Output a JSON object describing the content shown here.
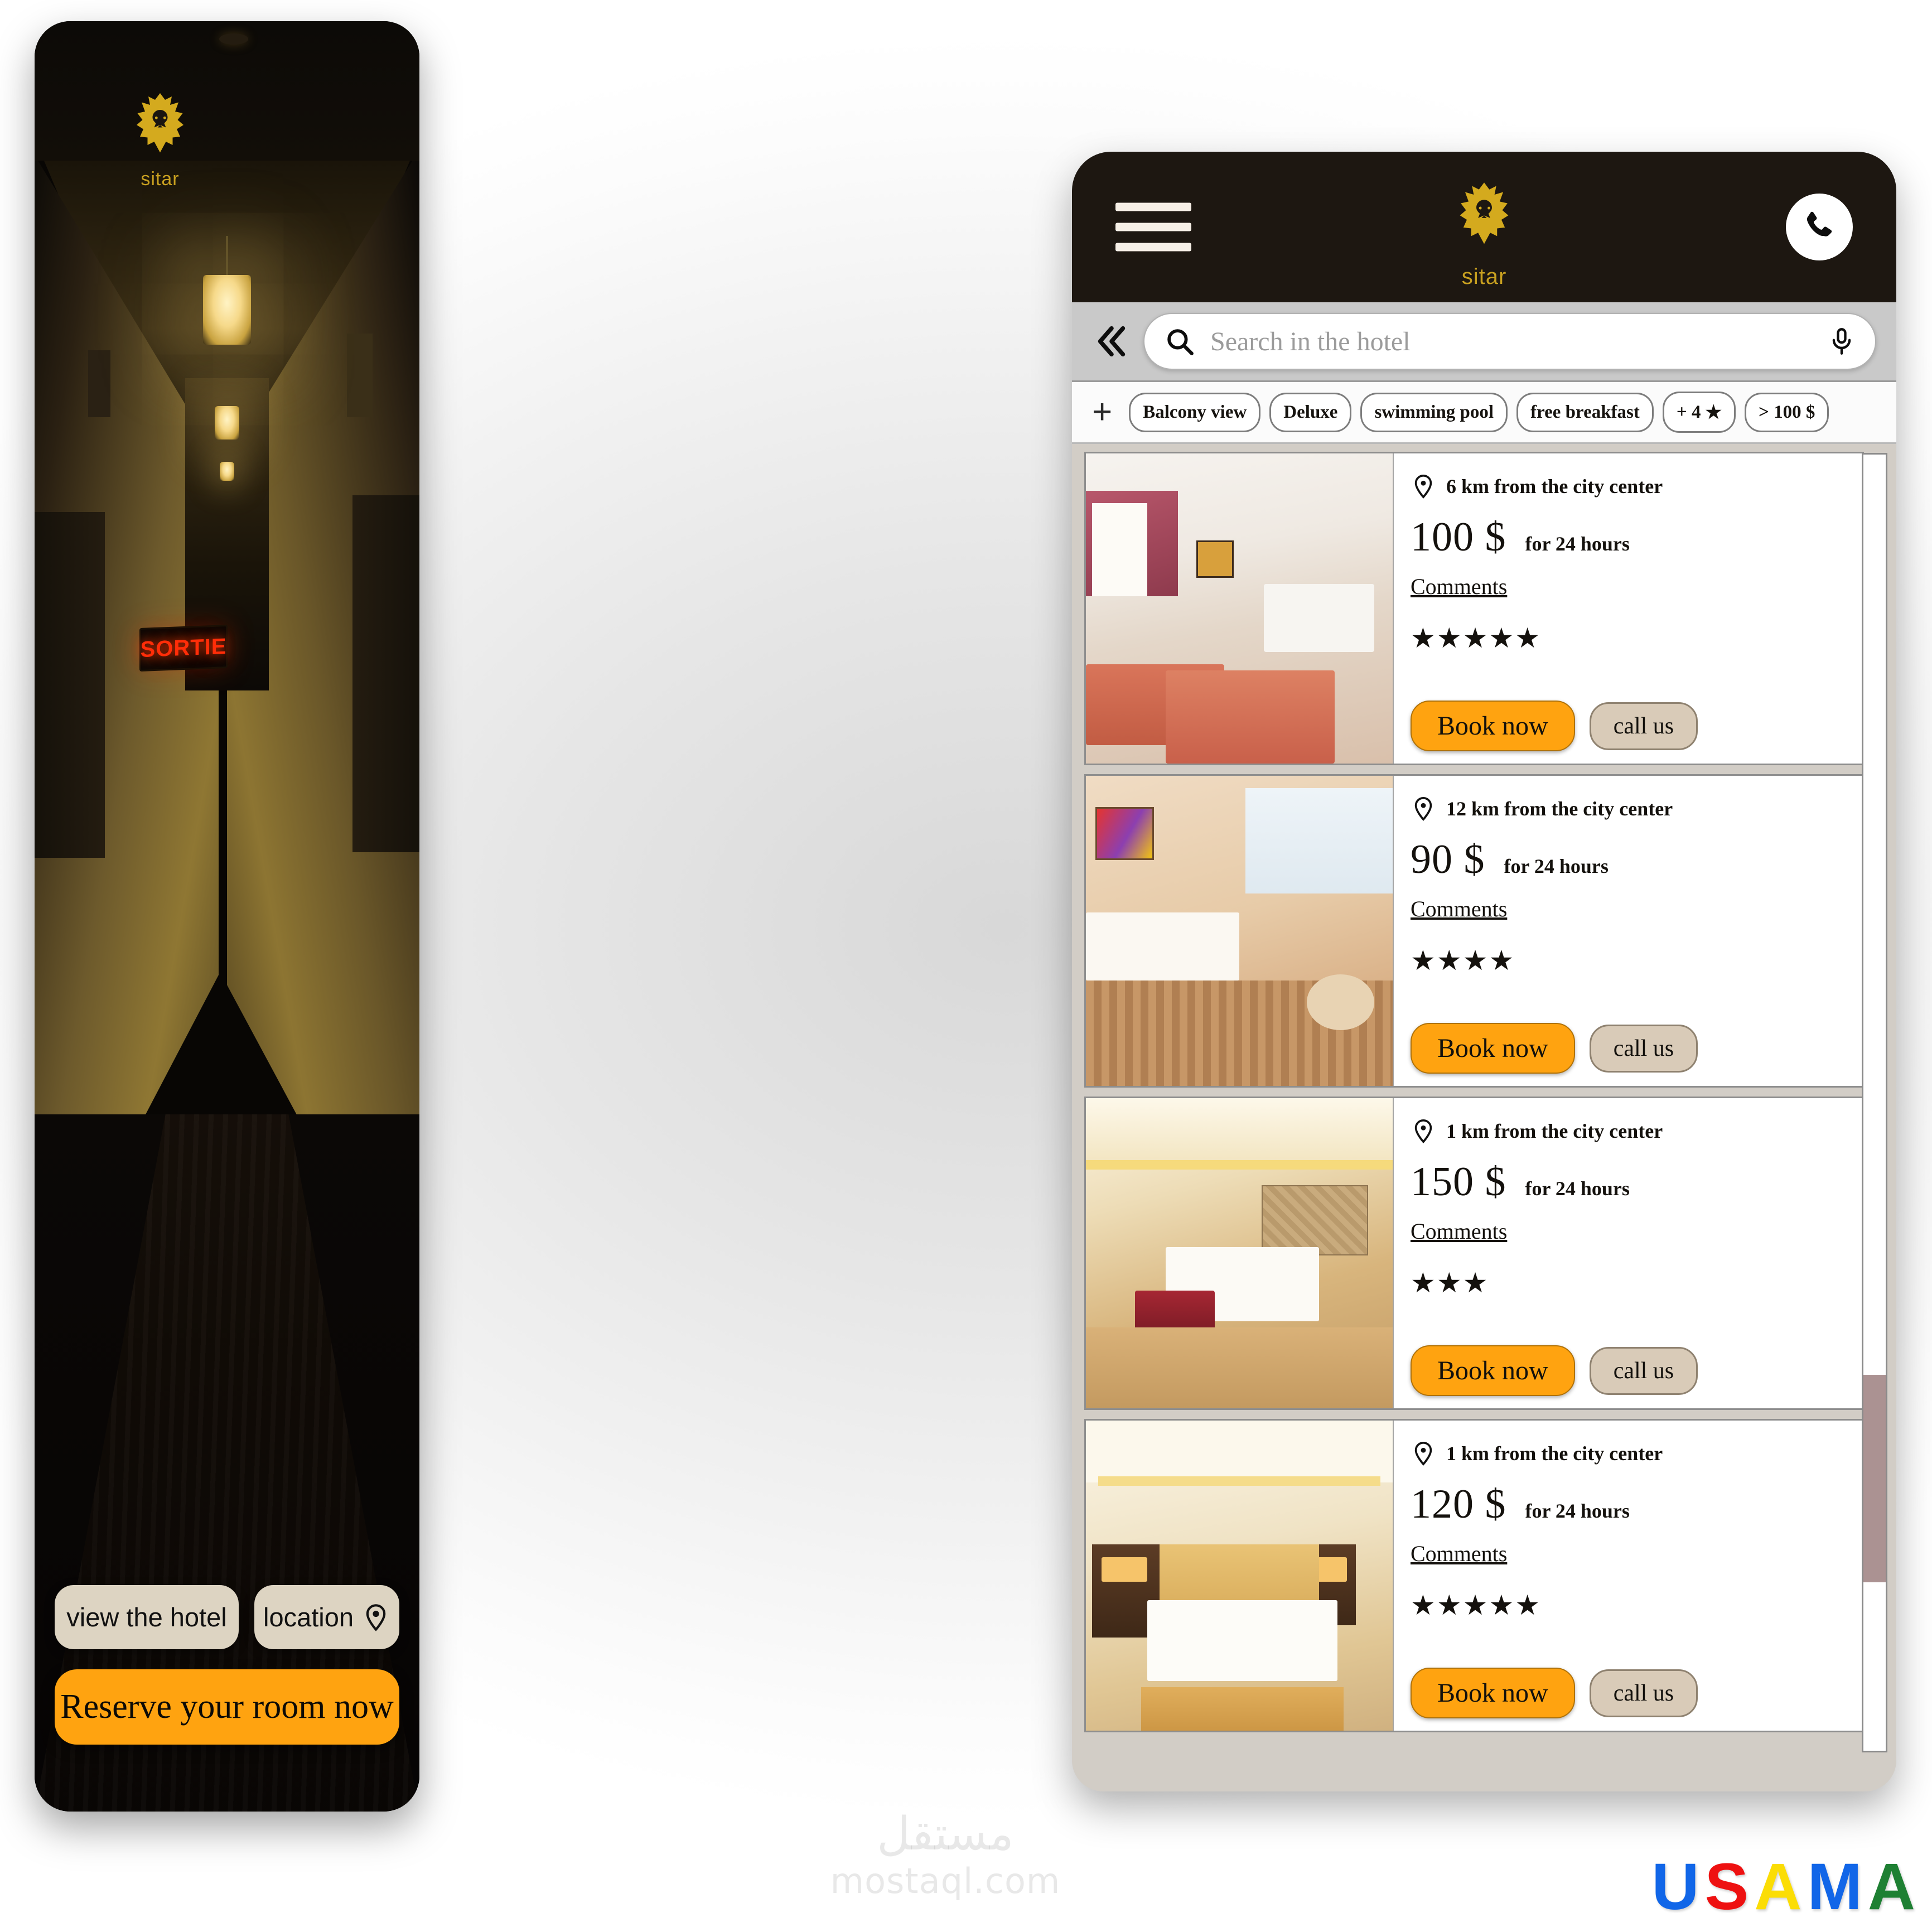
{
  "brand": {
    "name": "sitar",
    "logo_icon": "lion-head-icon",
    "logo_color": "#d4aa1e"
  },
  "left_screen": {
    "hero_alt": "hotel-corridor-photo",
    "exit_sign": "SORTIE",
    "buttons": {
      "view_hotel": "view the hotel",
      "location": "location",
      "location_icon": "map-pin-icon",
      "reserve": "Reserve your room now"
    }
  },
  "right_screen": {
    "header": {
      "menu_icon": "hamburger-menu-icon",
      "call_icon": "phone-icon",
      "brand": "sitar"
    },
    "search": {
      "back_icon": "double-chevron-left-icon",
      "search_icon": "search-icon",
      "placeholder": "Search in the hotel",
      "value": "",
      "mic_icon": "microphone-icon"
    },
    "filters": {
      "add_icon": "plus-icon",
      "chips": [
        {
          "label": "Balcony view"
        },
        {
          "label": "Deluxe"
        },
        {
          "label": "swimming pool"
        },
        {
          "label": "free breakfast"
        },
        {
          "label": "+ 4",
          "icon": "star-icon"
        },
        {
          "label": "> 100 $"
        }
      ]
    },
    "labels": {
      "comments": "Comments",
      "book_now": "Book now",
      "call_us": "call us",
      "pin_icon": "map-pin-icon"
    },
    "cards": [
      {
        "distance": "6 km from the city center",
        "price": "100 $",
        "period": "for 24 hours",
        "comments": "Comments",
        "rating": 5,
        "stars": "★★★★★",
        "book_now": "Book now",
        "call_us": "call us",
        "image_alt": "twin-beds-room-photo"
      },
      {
        "distance": "12 km from the city center",
        "price": "90 $",
        "period": "for 24 hours",
        "comments": "Comments",
        "rating": 4,
        "stars": "★★★★",
        "book_now": "Book now",
        "call_us": "call us",
        "image_alt": "suite-with-window-photo"
      },
      {
        "distance": "1 km from the city center",
        "price": "150 $",
        "period": "for 24 hours",
        "comments": "Comments",
        "rating": 3,
        "stars": "★★★",
        "book_now": "Book now",
        "call_us": "call us",
        "image_alt": "luxury-king-room-photo"
      },
      {
        "distance": "1 km from the city center",
        "price": "120 $",
        "period": "for 24 hours",
        "comments": "Comments",
        "rating": 5,
        "stars": "★★★★★",
        "book_now": "Book now",
        "call_us": "call us",
        "image_alt": "modern-bedroom-photo"
      }
    ],
    "scrollbar": {
      "thumb_top_pct": 71,
      "thumb_height_pct": 16
    }
  },
  "watermarks": {
    "mostaql_ar": "مستقل",
    "mostaql_en": "mostaql.com",
    "usama": [
      {
        "ch": "U",
        "color": "#1166e8"
      },
      {
        "ch": "S",
        "color": "#ee1111"
      },
      {
        "ch": "A",
        "color": "#fbdd05"
      },
      {
        "ch": "M",
        "color": "#1166e8"
      },
      {
        "ch": "A",
        "color": "#1e8033"
      }
    ]
  },
  "colors": {
    "accent_orange": "#ffa310",
    "brand_gold": "#d4aa1e",
    "dark": "#1d1711",
    "pale": "#ddd4c2",
    "call_beige": "#d9cbb8"
  }
}
